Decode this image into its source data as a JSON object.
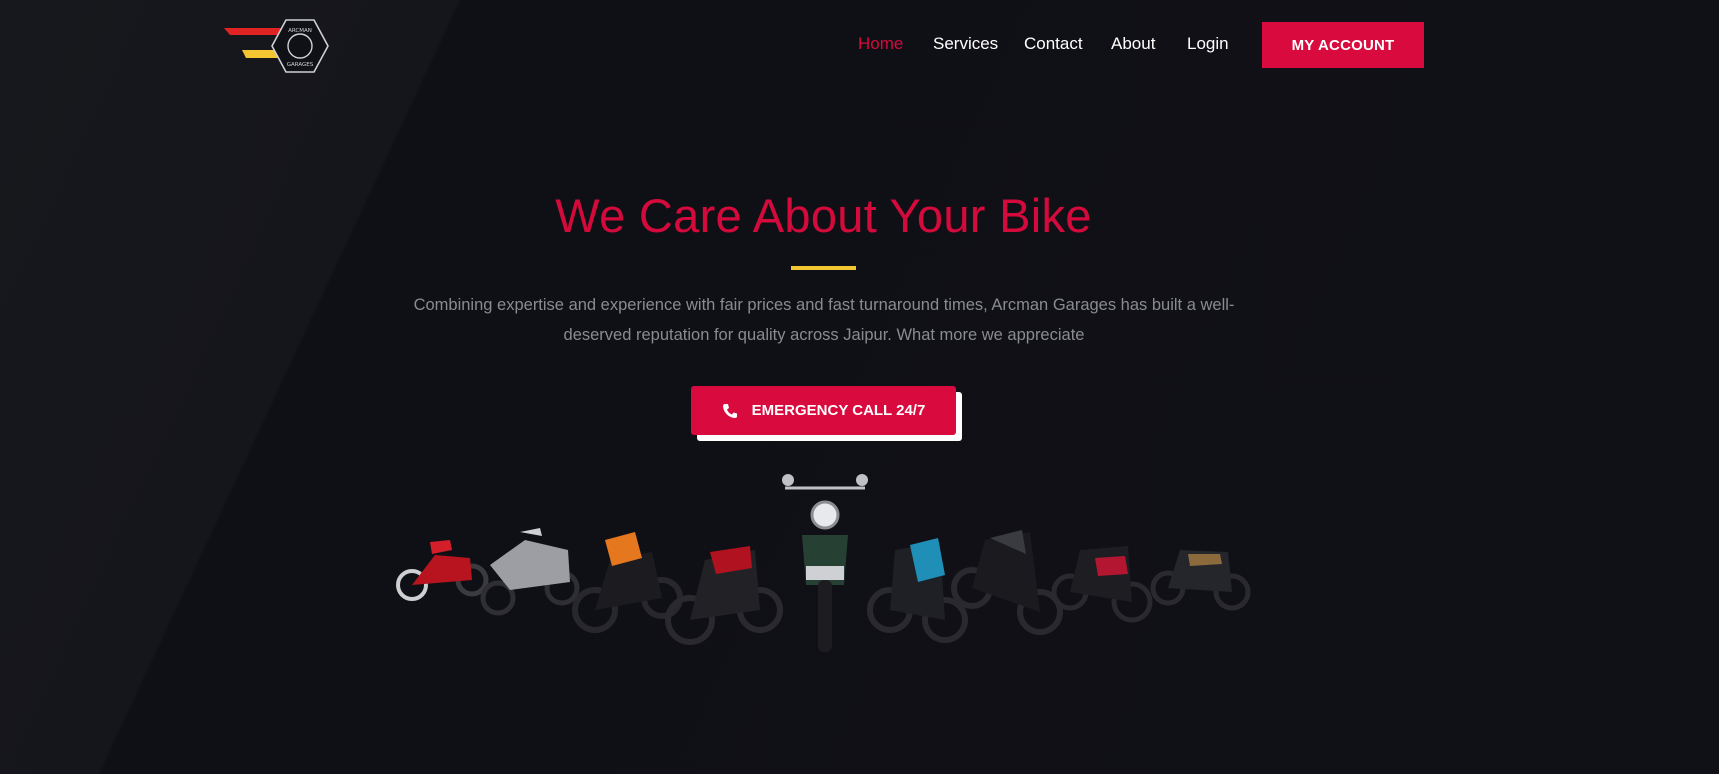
{
  "header": {
    "logo": {
      "icon": "arcman-garages-logo",
      "text": "ARCMAN GARAGES",
      "colors": {
        "red": "#e02424",
        "yellow": "#f2c531"
      }
    },
    "nav": [
      {
        "label": "Home",
        "active": true
      },
      {
        "label": "Services",
        "active": false
      },
      {
        "label": "Contact",
        "active": false
      },
      {
        "label": "About",
        "active": false
      },
      {
        "label": "Login",
        "active": false
      }
    ],
    "account_button": "MY ACCOUNT"
  },
  "hero": {
    "title": "We Care About Your Bike",
    "description_line1": "Combining expertise and experience with fair prices and fast turnaround times, Arcman Garages has built a well-",
    "description_line2": "deserved reputation for quality across Jaipur. What more we appreciate",
    "cta_label": "EMERGENCY CALL 24/7",
    "cta_icon": "phone-icon",
    "image": "motorcycles-lineup"
  },
  "colors": {
    "accent": "#d90a3d",
    "rule": "#f2c531",
    "background": "#101116"
  }
}
